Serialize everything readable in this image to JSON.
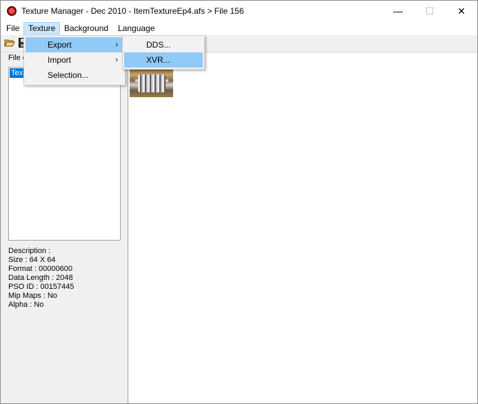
{
  "window": {
    "title": "Texture Manager - Dec 2010 - ItemTextureEp4.afs > File 156",
    "minimize_glyph": "—",
    "maximize_glyph": "☐",
    "close_glyph": "✕"
  },
  "menubar": {
    "items": [
      "File",
      "Texture",
      "Background",
      "Language"
    ]
  },
  "texture_menu": {
    "items": [
      {
        "label": "Export",
        "arrow": "›"
      },
      {
        "label": "Import",
        "arrow": "›"
      },
      {
        "label": "Selection..."
      }
    ]
  },
  "export_submenu": {
    "items": [
      {
        "label": "DDS..."
      },
      {
        "label": "XVR..."
      }
    ]
  },
  "toolbar": {
    "icons": [
      "open-folder-icon",
      "save-disk-icon"
    ]
  },
  "left_panel": {
    "group_label": "File c",
    "tree_node": "Tex"
  },
  "properties": {
    "description": "Description :",
    "size": "Size : 64 X 64",
    "format": "Format : 00000600",
    "data_length": "Data Length : 2048",
    "pso_id": "PSO ID : 00157445",
    "mip_maps": "Mip Maps : No",
    "alpha": "Alpha : No"
  },
  "colors": {
    "menu_open_bg": "#cce8ff",
    "submenu_highlight": "#91c9f7",
    "tree_selection": "#0078d7"
  }
}
